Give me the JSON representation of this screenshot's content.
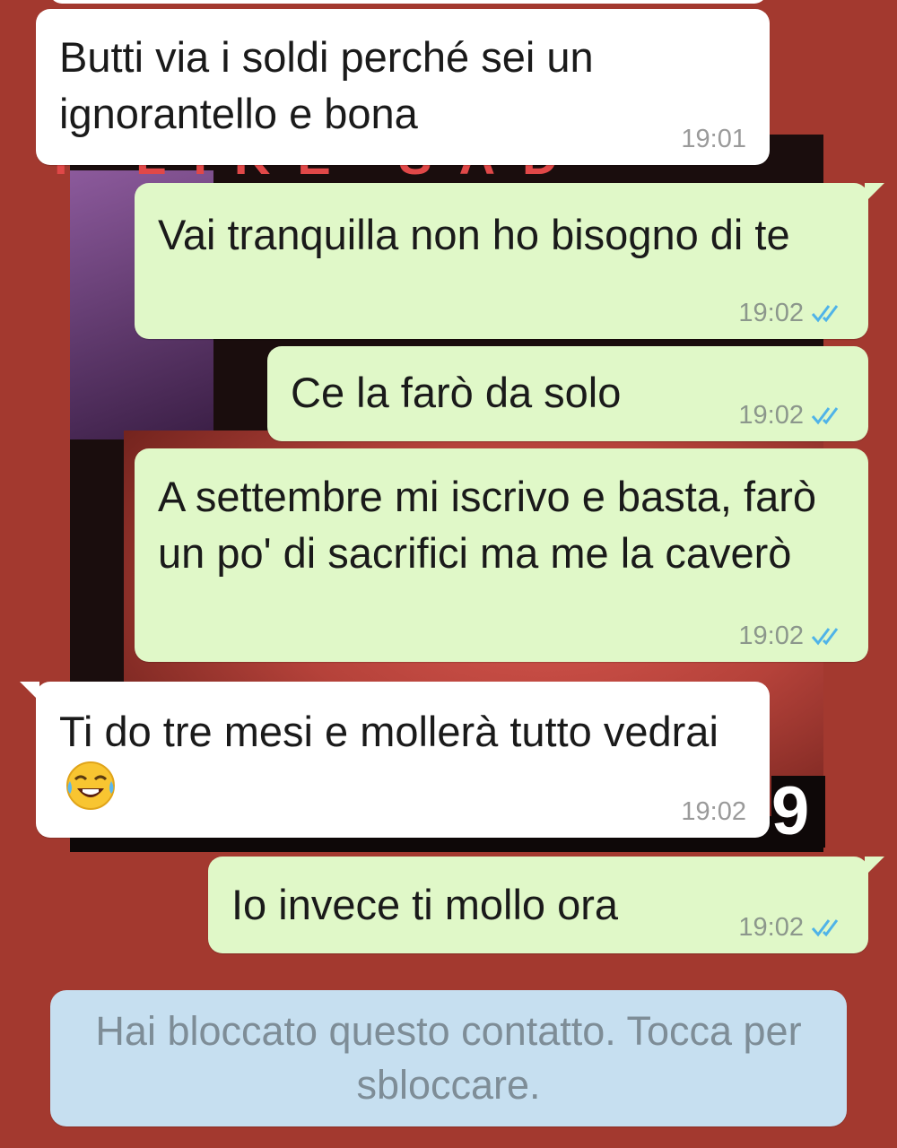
{
  "messages": [
    {
      "direction": "in",
      "text": "Butti via i soldi perché sei un ignorantello e bona",
      "time": "19:01",
      "read": false
    },
    {
      "direction": "out",
      "text": "Vai tranquilla non ho bisogno di te",
      "time": "19:02",
      "read": true
    },
    {
      "direction": "out",
      "text": "Ce la farò da solo",
      "time": "19:02",
      "read": true
    },
    {
      "direction": "out",
      "text": "A settembre mi iscrivo e basta, farò un po' di sacrifici ma me la caverò",
      "time": "19:02",
      "read": true
    },
    {
      "direction": "in",
      "text": "Ti do tre mesi e mollerà tutto vedrai",
      "time": "19:02",
      "read": false,
      "emoji": "face-with-tears-of-joy"
    },
    {
      "direction": "out",
      "text": "Io invece ti mollo ora",
      "time": "19:02",
      "read": true
    }
  ],
  "system_notice": "Hai bloccato questo contatto. Tocca per sbloccare.",
  "wallpaper": {
    "top_text": "I LIKE SAD EYES",
    "corner_digit": "9"
  },
  "colors": {
    "background": "#a3392f",
    "incoming_bubble": "#ffffff",
    "outgoing_bubble": "#e0f8c8",
    "read_ticks": "#4fb3e8",
    "system_bubble": "#c6dff0"
  }
}
